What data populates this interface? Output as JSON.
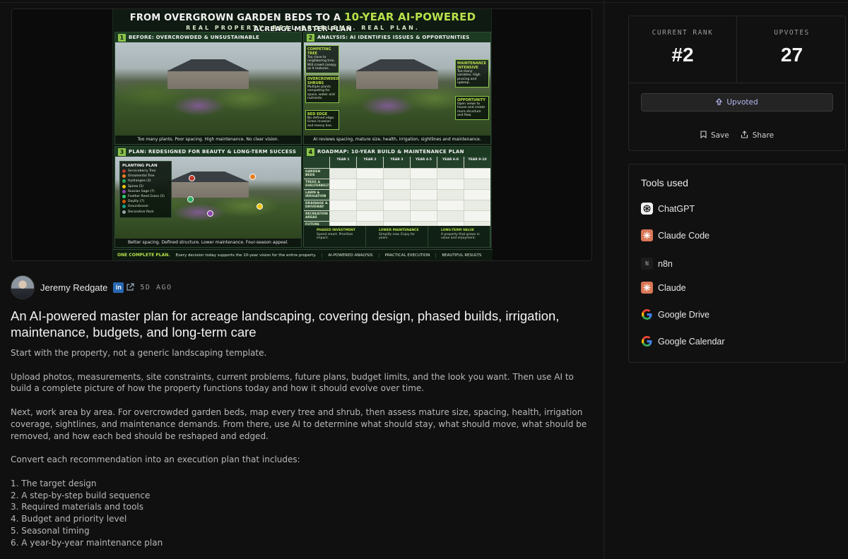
{
  "hero": {
    "title_pre": "FROM OVERGROWN GARDEN BEDS TO A",
    "title_highlight": "10-YEAR AI-POWERED",
    "title_post": "ACREAGE MASTER PLAN",
    "subtitle": "REAL PROPERTY. REAL PROBLEMS. REAL PLAN.",
    "panels": [
      {
        "num": "1",
        "title": "BEFORE: OVERCROWDED & UNSUSTAINABLE",
        "caption": "Too many plants. Poor spacing. High maintenance. No clear vision."
      },
      {
        "num": "2",
        "title": "ANALYSIS: AI IDENTIFIES ISSUES & OPPORTUNITIES",
        "caption": "AI reviews spacing, mature size, health, irrigation, sightlines and maintenance."
      },
      {
        "num": "3",
        "title": "PLAN: REDESIGNED FOR BEAUTY & LONG-TERM SUCCESS",
        "caption": "Better spacing. Defined structure. Lower maintenance. Four-season appeal."
      },
      {
        "num": "4",
        "title": "ROADMAP: 10-YEAR BUILD & MAINTENANCE PLAN",
        "caption": ""
      }
    ],
    "notes": [
      {
        "title": "COMPETING TREE",
        "text": "Too close to neighboring tree. Will crowd canopy as it matures."
      },
      {
        "title": "OVERCROWDED SHRUBS",
        "text": "Multiple plants competing for space, water and nutrients."
      },
      {
        "title": "BED EDGE",
        "text": "No defined edge. Grass invasion and messy line."
      },
      {
        "title": "MAINTENANCE INTENSIVE",
        "text": "Too many varieties. High pruning and upkeep."
      },
      {
        "title": "OPPORTUNITY",
        "text": "Open views to house and create more structure and flow."
      }
    ],
    "legend_title": "PLANTING PLAN",
    "legend": [
      {
        "label": "Serviceberry Tree",
        "color": "#c0392b"
      },
      {
        "label": "Ornamental Tree",
        "color": "#e67e22"
      },
      {
        "label": "Hydrangea (3)",
        "color": "#27ae60"
      },
      {
        "label": "Spirea (5)",
        "color": "#f1c40f"
      },
      {
        "label": "Russian Sage (7)",
        "color": "#8e44ad"
      },
      {
        "label": "Feather Reed Grass (5)",
        "color": "#2ecc71"
      },
      {
        "label": "Daylily (7)",
        "color": "#d35400"
      },
      {
        "label": "Groundcover",
        "color": "#16a085"
      },
      {
        "label": "Decorative Rock",
        "color": "#95a5a6"
      }
    ],
    "roadmap_cols": [
      "YEAR 1",
      "YEAR 2",
      "YEAR 3",
      "YEAR 4-5",
      "YEAR 6-8",
      "YEAR 9-10"
    ],
    "roadmap_rows": [
      "GARDEN BEDS",
      "TREES & SHELTERBELTS",
      "LAWN & IRRIGATION",
      "DRAINAGE & DRIVEWAY",
      "RECREATION AREAS",
      "FUTURE PROJECTS"
    ],
    "roadmap_footer": [
      {
        "title": "PHASED INVESTMENT",
        "text": "Spend smart. Prioritize impact."
      },
      {
        "title": "LOWER MAINTENANCE",
        "text": "Simplify now. Enjoy for years."
      },
      {
        "title": "LONG-TERM VALUE",
        "text": "A property that grows in value and enjoyment."
      }
    ],
    "footer_one": "ONE COMPLETE PLAN.",
    "footer_one_text": "Every decision today supports the 10-year vision for the entire property.",
    "footer_tags": [
      "AI-POWERED ANALYSIS",
      "PRACTICAL EXECUTION",
      "BEAUTIFUL RESULTS"
    ]
  },
  "author": {
    "name": "Jeremy Redgate",
    "linkedin_label": "in",
    "age": "5D AGO"
  },
  "post": {
    "title": "An AI-powered master plan for acreage landscaping, covering design, phased builds, irrigation, maintenance, budgets, and long-term care",
    "paragraphs": [
      "Start with the property, not a generic landscaping template.",
      "Upload photos, measurements, site constraints, current problems, future plans, budget limits, and the look you want. Then use AI to build a complete picture of how the property functions today and how it should evolve over time.",
      "Next, work area by area. For overcrowded garden beds, map every tree and shrub, then assess mature size, spacing, health, irrigation coverage, sightlines, and maintenance demands. From there, use AI to determine what should stay, what should move, what should be removed, and how each bed should be reshaped and edged.",
      "Convert each recommendation into an execution plan that includes:"
    ],
    "list": [
      "1. The target design",
      "2. A step-by-step build sequence",
      "3. Required materials and tools",
      "4. Budget and priority level",
      "5. Seasonal timing",
      "6. A year-by-year maintenance plan"
    ]
  },
  "stats": {
    "rank_label": "CURRENT RANK",
    "rank_value": "#2",
    "upvotes_label": "UPVOTES",
    "upvotes_value": "27",
    "upvote_button": "Upvoted",
    "save_label": "Save",
    "share_label": "Share"
  },
  "tools": {
    "title": "Tools used",
    "items": [
      {
        "name": "ChatGPT",
        "icon": "chatgpt-icon"
      },
      {
        "name": "Claude Code",
        "icon": "claude-icon"
      },
      {
        "name": "n8n",
        "icon": "n8n-icon",
        "glyph": "N"
      },
      {
        "name": "Claude",
        "icon": "claude-icon"
      },
      {
        "name": "Google Drive",
        "icon": "google-icon"
      },
      {
        "name": "Google Calendar",
        "icon": "google-icon"
      }
    ]
  },
  "colors": {
    "background": "#101010",
    "card": "#111111",
    "accent_upvote": "#b9b9f5",
    "poster_green": "#b8e04a"
  }
}
